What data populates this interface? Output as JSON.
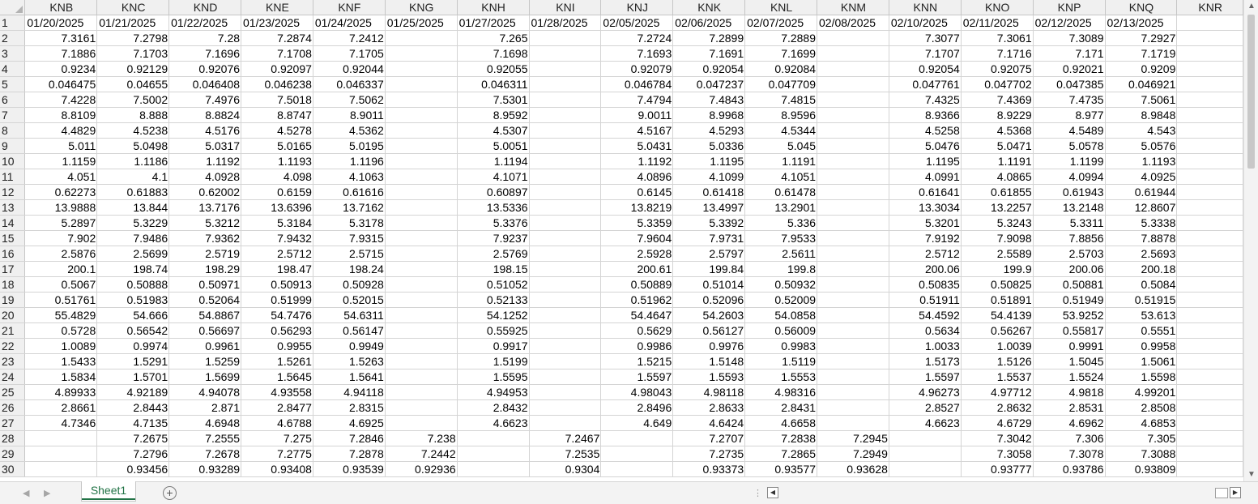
{
  "columns": [
    "KNB",
    "KNC",
    "KND",
    "KNE",
    "KNF",
    "KNG",
    "KNH",
    "KNI",
    "KNJ",
    "KNK",
    "KNL",
    "KNM",
    "KNN",
    "KNO",
    "KNP",
    "KNQ",
    "KNR"
  ],
  "rows": [
    {
      "n": "1",
      "cells": [
        "01/20/2025",
        "01/21/2025",
        "01/22/2025",
        "01/23/2025",
        "01/24/2025",
        "01/25/2025",
        "01/27/2025",
        "01/28/2025",
        "02/05/2025",
        "02/06/2025",
        "02/07/2025",
        "02/08/2025",
        "02/10/2025",
        "02/11/2025",
        "02/12/2025",
        "02/13/2025",
        ""
      ]
    },
    {
      "n": "2",
      "cells": [
        "7.3161",
        "7.2798",
        "7.28",
        "7.2874",
        "7.2412",
        "",
        "7.265",
        "",
        "7.2724",
        "7.2899",
        "7.2889",
        "",
        "7.3077",
        "7.3061",
        "7.3089",
        "7.2927",
        ""
      ]
    },
    {
      "n": "3",
      "cells": [
        "7.1886",
        "7.1703",
        "7.1696",
        "7.1708",
        "7.1705",
        "",
        "7.1698",
        "",
        "7.1693",
        "7.1691",
        "7.1699",
        "",
        "7.1707",
        "7.1716",
        "7.171",
        "7.1719",
        ""
      ]
    },
    {
      "n": "4",
      "cells": [
        "0.9234",
        "0.92129",
        "0.92076",
        "0.92097",
        "0.92044",
        "",
        "0.92055",
        "",
        "0.92079",
        "0.92054",
        "0.92084",
        "",
        "0.92054",
        "0.92075",
        "0.92021",
        "0.9209",
        ""
      ]
    },
    {
      "n": "5",
      "cells": [
        "0.046475",
        "0.04655",
        "0.046408",
        "0.046238",
        "0.046337",
        "",
        "0.046311",
        "",
        "0.046784",
        "0.047237",
        "0.047709",
        "",
        "0.047761",
        "0.047702",
        "0.047385",
        "0.046921",
        ""
      ]
    },
    {
      "n": "6",
      "cells": [
        "7.4228",
        "7.5002",
        "7.4976",
        "7.5018",
        "7.5062",
        "",
        "7.5301",
        "",
        "7.4794",
        "7.4843",
        "7.4815",
        "",
        "7.4325",
        "7.4369",
        "7.4735",
        "7.5061",
        ""
      ]
    },
    {
      "n": "7",
      "cells": [
        "8.8109",
        "8.888",
        "8.8824",
        "8.8747",
        "8.9011",
        "",
        "8.9592",
        "",
        "9.0011",
        "8.9968",
        "8.9596",
        "",
        "8.9366",
        "8.9229",
        "8.977",
        "8.9848",
        ""
      ]
    },
    {
      "n": "8",
      "cells": [
        "4.4829",
        "4.5238",
        "4.5176",
        "4.5278",
        "4.5362",
        "",
        "4.5307",
        "",
        "4.5167",
        "4.5293",
        "4.5344",
        "",
        "4.5258",
        "4.5368",
        "4.5489",
        "4.543",
        ""
      ]
    },
    {
      "n": "9",
      "cells": [
        "5.011",
        "5.0498",
        "5.0317",
        "5.0165",
        "5.0195",
        "",
        "5.0051",
        "",
        "5.0431",
        "5.0336",
        "5.045",
        "",
        "5.0476",
        "5.0471",
        "5.0578",
        "5.0576",
        ""
      ]
    },
    {
      "n": "10",
      "cells": [
        "1.1159",
        "1.1186",
        "1.1192",
        "1.1193",
        "1.1196",
        "",
        "1.1194",
        "",
        "1.1192",
        "1.1195",
        "1.1191",
        "",
        "1.1195",
        "1.1191",
        "1.1199",
        "1.1193",
        ""
      ]
    },
    {
      "n": "11",
      "cells": [
        "4.051",
        "4.1",
        "4.0928",
        "4.098",
        "4.1063",
        "",
        "4.1071",
        "",
        "4.0896",
        "4.1099",
        "4.1051",
        "",
        "4.0991",
        "4.0865",
        "4.0994",
        "4.0925",
        ""
      ]
    },
    {
      "n": "12",
      "cells": [
        "0.62273",
        "0.61883",
        "0.62002",
        "0.6159",
        "0.61616",
        "",
        "0.60897",
        "",
        "0.6145",
        "0.61418",
        "0.61478",
        "",
        "0.61641",
        "0.61855",
        "0.61943",
        "0.61944",
        ""
      ]
    },
    {
      "n": "13",
      "cells": [
        "13.9888",
        "13.844",
        "13.7176",
        "13.6396",
        "13.7162",
        "",
        "13.5336",
        "",
        "13.8219",
        "13.4997",
        "13.2901",
        "",
        "13.3034",
        "13.2257",
        "13.2148",
        "12.8607",
        ""
      ]
    },
    {
      "n": "14",
      "cells": [
        "5.2897",
        "5.3229",
        "5.3212",
        "5.3184",
        "5.3178",
        "",
        "5.3376",
        "",
        "5.3359",
        "5.3392",
        "5.336",
        "",
        "5.3201",
        "5.3243",
        "5.3311",
        "5.3338",
        ""
      ]
    },
    {
      "n": "15",
      "cells": [
        "7.902",
        "7.9486",
        "7.9362",
        "7.9432",
        "7.9315",
        "",
        "7.9237",
        "",
        "7.9604",
        "7.9731",
        "7.9533",
        "",
        "7.9192",
        "7.9098",
        "7.8856",
        "7.8878",
        ""
      ]
    },
    {
      "n": "16",
      "cells": [
        "2.5876",
        "2.5699",
        "2.5719",
        "2.5712",
        "2.5715",
        "",
        "2.5769",
        "",
        "2.5928",
        "2.5797",
        "2.5611",
        "",
        "2.5712",
        "2.5589",
        "2.5703",
        "2.5693",
        ""
      ]
    },
    {
      "n": "17",
      "cells": [
        "200.1",
        "198.74",
        "198.29",
        "198.47",
        "198.24",
        "",
        "198.15",
        "",
        "200.61",
        "199.84",
        "199.8",
        "",
        "200.06",
        "199.9",
        "200.06",
        "200.18",
        ""
      ]
    },
    {
      "n": "18",
      "cells": [
        "0.5067",
        "0.50888",
        "0.50971",
        "0.50913",
        "0.50928",
        "",
        "0.51052",
        "",
        "0.50889",
        "0.51014",
        "0.50932",
        "",
        "0.50835",
        "0.50825",
        "0.50881",
        "0.5084",
        ""
      ]
    },
    {
      "n": "19",
      "cells": [
        "0.51761",
        "0.51983",
        "0.52064",
        "0.51999",
        "0.52015",
        "",
        "0.52133",
        "",
        "0.51962",
        "0.52096",
        "0.52009",
        "",
        "0.51911",
        "0.51891",
        "0.51949",
        "0.51915",
        ""
      ]
    },
    {
      "n": "20",
      "cells": [
        "55.4829",
        "54.666",
        "54.8867",
        "54.7476",
        "54.6311",
        "",
        "54.1252",
        "",
        "54.4647",
        "54.2603",
        "54.0858",
        "",
        "54.4592",
        "54.4139",
        "53.9252",
        "53.613",
        ""
      ]
    },
    {
      "n": "21",
      "cells": [
        "0.5728",
        "0.56542",
        "0.56697",
        "0.56293",
        "0.56147",
        "",
        "0.55925",
        "",
        "0.5629",
        "0.56127",
        "0.56009",
        "",
        "0.5634",
        "0.56267",
        "0.55817",
        "0.5551",
        ""
      ]
    },
    {
      "n": "22",
      "cells": [
        "1.0089",
        "0.9974",
        "0.9961",
        "0.9955",
        "0.9949",
        "",
        "0.9917",
        "",
        "0.9986",
        "0.9976",
        "0.9983",
        "",
        "1.0033",
        "1.0039",
        "0.9991",
        "0.9958",
        ""
      ]
    },
    {
      "n": "23",
      "cells": [
        "1.5433",
        "1.5291",
        "1.5259",
        "1.5261",
        "1.5263",
        "",
        "1.5199",
        "",
        "1.5215",
        "1.5148",
        "1.5119",
        "",
        "1.5173",
        "1.5126",
        "1.5045",
        "1.5061",
        ""
      ]
    },
    {
      "n": "24",
      "cells": [
        "1.5834",
        "1.5701",
        "1.5699",
        "1.5645",
        "1.5641",
        "",
        "1.5595",
        "",
        "1.5597",
        "1.5593",
        "1.5553",
        "",
        "1.5597",
        "1.5537",
        "1.5524",
        "1.5598",
        ""
      ]
    },
    {
      "n": "25",
      "cells": [
        "4.89933",
        "4.92189",
        "4.94078",
        "4.93558",
        "4.94118",
        "",
        "4.94953",
        "",
        "4.98043",
        "4.98118",
        "4.98316",
        "",
        "4.96273",
        "4.97712",
        "4.9818",
        "4.99201",
        ""
      ]
    },
    {
      "n": "26",
      "cells": [
        "2.8661",
        "2.8443",
        "2.871",
        "2.8477",
        "2.8315",
        "",
        "2.8432",
        "",
        "2.8496",
        "2.8633",
        "2.8431",
        "",
        "2.8527",
        "2.8632",
        "2.8531",
        "2.8508",
        ""
      ]
    },
    {
      "n": "27",
      "cells": [
        "4.7346",
        "4.7135",
        "4.6948",
        "4.6788",
        "4.6925",
        "",
        "4.6623",
        "",
        "4.649",
        "4.6424",
        "4.6658",
        "",
        "4.6623",
        "4.6729",
        "4.6962",
        "4.6853",
        ""
      ]
    },
    {
      "n": "28",
      "cells": [
        "",
        "7.2675",
        "7.2555",
        "7.275",
        "7.2846",
        "7.238",
        "",
        "7.2467",
        "",
        "7.2707",
        "7.2838",
        "7.2945",
        "",
        "7.3042",
        "7.306",
        "7.305",
        ""
      ]
    },
    {
      "n": "29",
      "cells": [
        "",
        "7.2796",
        "7.2678",
        "7.2775",
        "7.2878",
        "7.2442",
        "",
        "7.2535",
        "",
        "7.2735",
        "7.2865",
        "7.2949",
        "",
        "7.3058",
        "7.3078",
        "7.3088",
        ""
      ]
    },
    {
      "n": "30",
      "cells": [
        "",
        "0.93456",
        "0.93289",
        "0.93408",
        "0.93539",
        "0.92936",
        "",
        "0.9304",
        "",
        "0.93373",
        "0.93577",
        "0.93628",
        "",
        "0.93777",
        "0.93786",
        "0.93809",
        ""
      ]
    }
  ],
  "sheet_tab": "Sheet1"
}
